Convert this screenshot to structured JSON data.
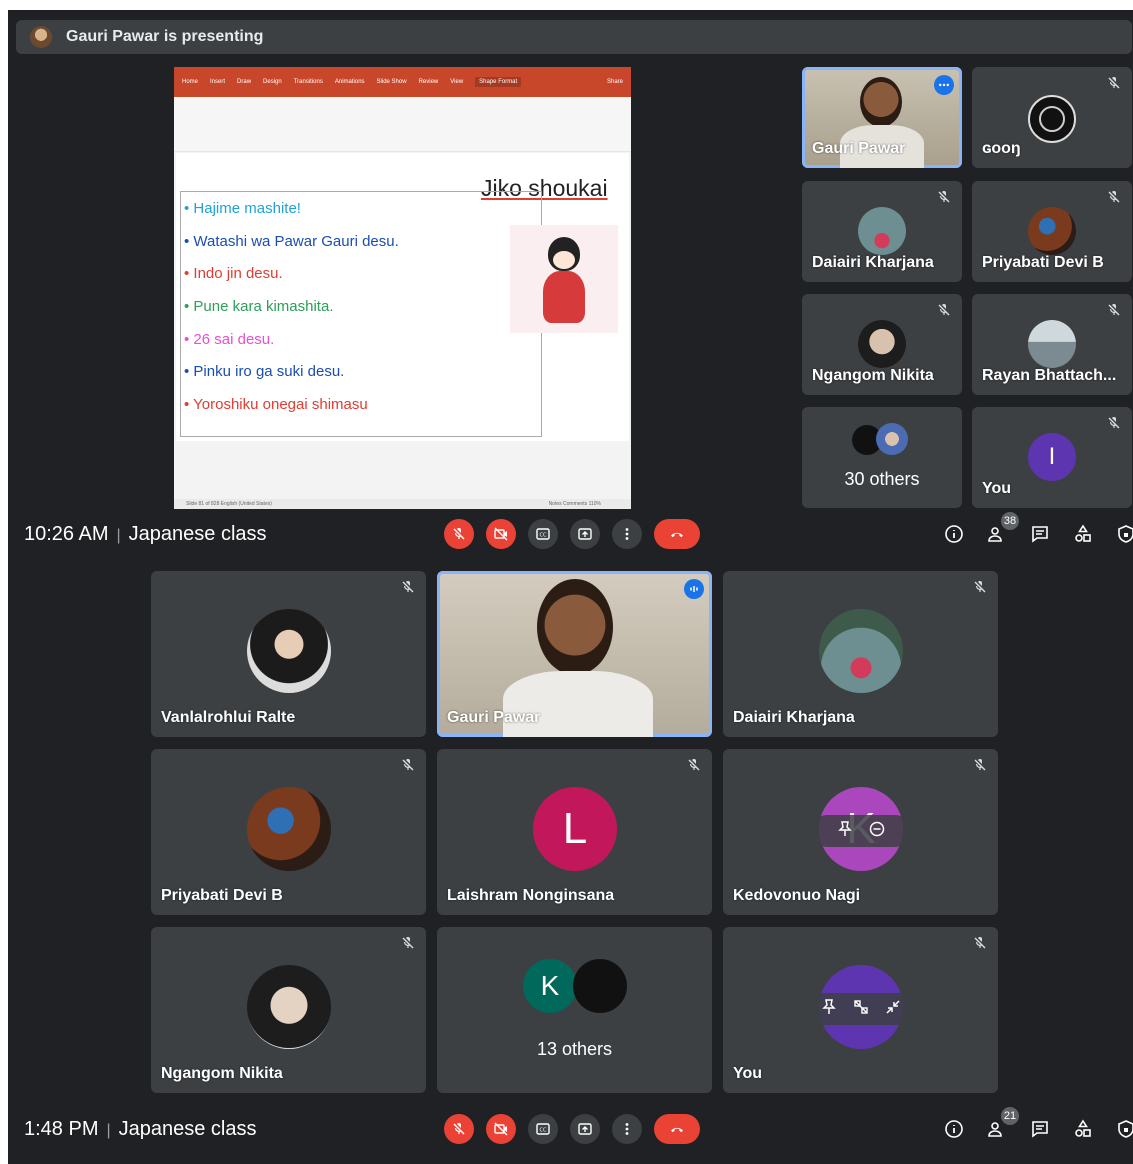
{
  "top": {
    "banner": {
      "text": "Gauri Pawar is presenting"
    },
    "slide": {
      "ribbon_tabs": [
        "Home",
        "Insert",
        "Draw",
        "Design",
        "Transitions",
        "Animations",
        "Slide Show",
        "Review",
        "View",
        "Shape Format"
      ],
      "ribbon_share": "Share",
      "title": "Jiko shoukai",
      "bullets": [
        {
          "text": "• Hajime mashite!",
          "color": "#1fa3d6"
        },
        {
          "text": "• Watashi wa Pawar Gauri desu.",
          "color": "#1a4db3"
        },
        {
          "text": "• Indo jin desu.",
          "color": "#e03c31"
        },
        {
          "text": "• Pune kara kimashita.",
          "color": "#2e9e58"
        },
        {
          "text": "• 26 sai desu.",
          "color": "#e84fd2"
        },
        {
          "text": "• Pinku iro ga suki desu.",
          "color": "#1a4db3"
        },
        {
          "text": "• Yoroshiku onegai shimasu",
          "color": "#e03c31"
        }
      ],
      "status_left": "Slide 81 of 828    English (United States)",
      "status_right": "Notes   Comments   110%"
    },
    "tiles": [
      {
        "name": "Gauri Pawar"
      },
      {
        "name": "ɢooŋ"
      },
      {
        "name": "Daiairi Kharjana"
      },
      {
        "name": "Priyabati Devi B"
      },
      {
        "name": "Ngangom Nikita"
      },
      {
        "name": "Rayan Bhattach..."
      },
      {
        "name": "30 others"
      },
      {
        "name": "You",
        "letter": "I"
      }
    ],
    "bar": {
      "time": "10:26 AM",
      "meeting": "Japanese class",
      "participants_count": "38"
    }
  },
  "bottom": {
    "tiles": [
      {
        "name": "Vanlalrohlui Ralte"
      },
      {
        "name": "Gauri Pawar"
      },
      {
        "name": "Daiairi Kharjana"
      },
      {
        "name": "Priyabati Devi B"
      },
      {
        "name": "Laishram Nonginsana",
        "letter": "L"
      },
      {
        "name": "Kedovonuo Nagi",
        "letter": "K"
      },
      {
        "name": "Ngangom Nikita"
      },
      {
        "name": "13 others",
        "letter": "K"
      },
      {
        "name": "You"
      }
    ],
    "bar": {
      "time": "1:48 PM",
      "meeting": "Japanese class",
      "participants_count": "21"
    }
  },
  "colors": {
    "background": "#202124",
    "tile": "#3c4043",
    "speaking_outline": "#8ab4f8",
    "danger": "#ea4335",
    "accent_blue": "#1a73e8",
    "avatar_you_top": "#5e35b1",
    "avatar_laishram": "#c2185b",
    "avatar_kedovonuo": "#ab47bc",
    "avatar_k_others": "#00695c"
  }
}
